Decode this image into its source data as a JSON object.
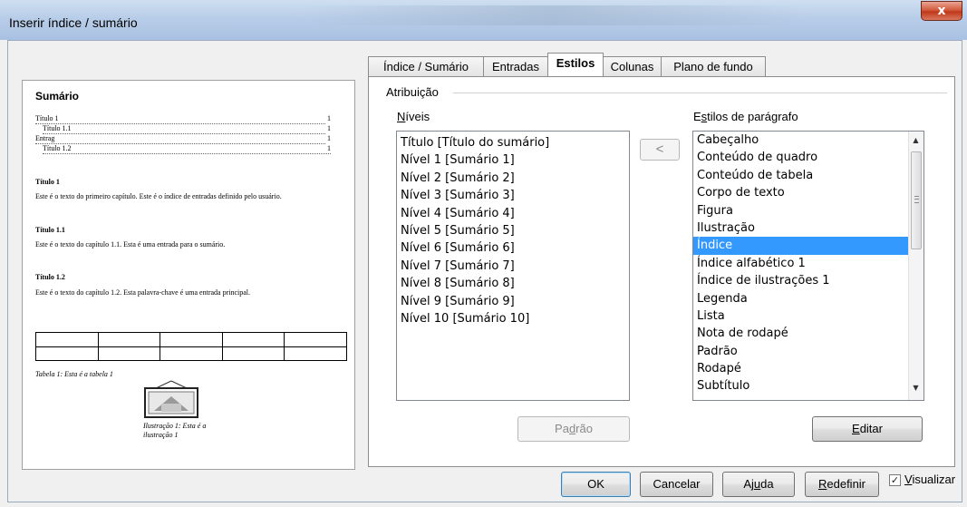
{
  "window": {
    "title": "Inserir índice / sumário",
    "close_glyph": "x"
  },
  "preview": {
    "heading": "Sumário",
    "toc": [
      {
        "text": "Título 1",
        "page": "1"
      },
      {
        "text": "Título 1.1",
        "page": "1"
      },
      {
        "text": "Entrag",
        "page": "1"
      },
      {
        "text": "Título 1.2",
        "page": "1"
      }
    ],
    "sections": [
      {
        "heading": "Título 1",
        "body": "Este é o texto do primeiro capítulo. Este é o índice de entradas definido pelo usuário."
      },
      {
        "heading": "Título 1.1",
        "body": "Este é o texto do capítulo 1.1. Esta é uma entrada para o sumário."
      },
      {
        "heading": "Título 1.2",
        "body": "Este é o texto do capítulo 1.2. Esta palavra-chave é uma entrada principal."
      }
    ],
    "table_caption": "Tabela 1: Esta é a tabela 1",
    "illustration_caption": "Ilustração 1: Esta é a ilustração 1"
  },
  "tabs": [
    {
      "label": "Índice / Sumário",
      "active": false
    },
    {
      "label": "Entradas",
      "active": false
    },
    {
      "label": "Estilos",
      "active": true
    },
    {
      "label": "Colunas",
      "active": false
    },
    {
      "label": "Plano de fundo",
      "active": false
    }
  ],
  "assignment": {
    "group_label": "Atribuição",
    "levels_label": "Níveis",
    "styles_label": "Estilos de parágrafo",
    "levels": [
      "Título [Título do sumário]",
      "Nível 1 [Sumário 1]",
      "Nível 2 [Sumário 2]",
      "Nível 3 [Sumário 3]",
      "Nível 4 [Sumário 4]",
      "Nível 5 [Sumário 5]",
      "Nível 6 [Sumário 6]",
      "Nível 7 [Sumário 7]",
      "Nível 8 [Sumário 8]",
      "Nível 9 [Sumário 9]",
      "Nível 10 [Sumário 10]"
    ],
    "paragraph_styles": [
      "Cabeçalho",
      "Conteúdo de quadro",
      "Conteúdo de tabela",
      "Corpo de texto",
      "Figura",
      "Ilustração",
      "Índice",
      "Índice alfabético 1",
      "Índice de ilustrações 1",
      "Legenda",
      "Lista",
      "Nota de rodapé",
      "Padrão",
      "Rodapé",
      "Subtítulo"
    ],
    "selected_style": "Índice",
    "assign_glyph": "<",
    "default_button": "Padrão",
    "edit_button": "Editar"
  },
  "footer": {
    "ok": "OK",
    "cancel": "Cancelar",
    "help": "Ajuda",
    "reset": "Redefinir",
    "preview_label": "Visualizar",
    "preview_checked": true
  }
}
